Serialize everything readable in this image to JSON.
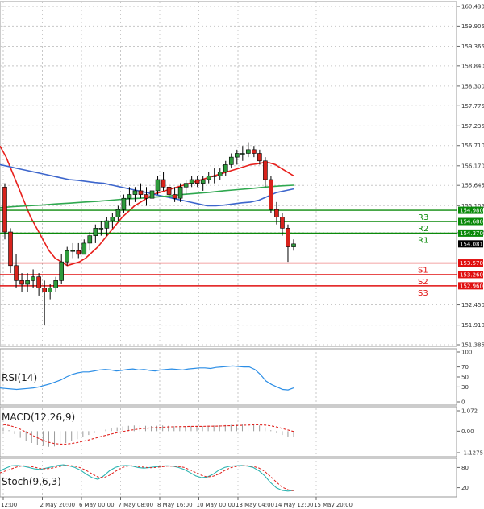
{
  "chart_data": {
    "type": "candlestick",
    "price_axis": {
      "ticks": [
        "160.430",
        "159.905",
        "159.365",
        "158.840",
        "158.300",
        "157.775",
        "157.235",
        "156.710",
        "156.170",
        "155.645",
        "155.105",
        "154.380",
        "152.450",
        "151.910",
        "151.385"
      ],
      "ylim": [
        151.385,
        160.43
      ]
    },
    "x_ticks": [
      "12:00",
      "2 May 20:00",
      "6 May 00:00",
      "7 May 08:00",
      "8 May 16:00",
      "10 May 00:00",
      "13 May 04:00",
      "14 May 12:00",
      "15 May 20:00"
    ],
    "candles": [
      [
        155.6,
        155.7,
        154.2,
        154.4
      ],
      [
        154.4,
        154.5,
        153.3,
        153.5
      ],
      [
        153.5,
        153.8,
        152.9,
        153.1
      ],
      [
        153.1,
        153.3,
        152.8,
        153.0
      ],
      [
        153.0,
        153.3,
        152.8,
        153.1
      ],
      [
        153.1,
        153.4,
        152.9,
        153.2
      ],
      [
        153.2,
        153.3,
        152.7,
        152.9
      ],
      [
        152.9,
        153.1,
        151.9,
        152.8
      ],
      [
        152.8,
        153.0,
        152.6,
        152.9
      ],
      [
        152.9,
        153.2,
        152.8,
        153.1
      ],
      [
        153.1,
        153.8,
        153.0,
        153.6
      ],
      [
        153.6,
        154.0,
        153.5,
        153.9
      ],
      [
        153.9,
        154.1,
        153.7,
        153.9
      ],
      [
        153.9,
        154.1,
        153.7,
        153.8
      ],
      [
        153.8,
        154.2,
        153.8,
        154.1
      ],
      [
        154.1,
        154.4,
        153.9,
        154.3
      ],
      [
        154.3,
        154.6,
        154.1,
        154.5
      ],
      [
        154.5,
        154.7,
        154.3,
        154.5
      ],
      [
        154.5,
        154.8,
        154.3,
        154.7
      ],
      [
        154.7,
        154.9,
        154.5,
        154.8
      ],
      [
        154.8,
        155.1,
        154.7,
        155.0
      ],
      [
        155.0,
        155.4,
        154.9,
        155.3
      ],
      [
        155.3,
        155.6,
        155.1,
        155.4
      ],
      [
        155.4,
        155.6,
        155.2,
        155.5
      ],
      [
        155.5,
        155.7,
        155.3,
        155.4
      ],
      [
        155.4,
        155.6,
        155.1,
        155.3
      ],
      [
        155.3,
        155.6,
        155.2,
        155.5
      ],
      [
        155.5,
        155.9,
        155.4,
        155.8
      ],
      [
        155.8,
        156.0,
        155.5,
        155.6
      ],
      [
        155.6,
        155.7,
        155.3,
        155.4
      ],
      [
        155.4,
        155.6,
        155.2,
        155.3
      ],
      [
        155.3,
        155.7,
        155.2,
        155.6
      ],
      [
        155.6,
        155.8,
        155.4,
        155.7
      ],
      [
        155.7,
        155.9,
        155.6,
        155.8
      ],
      [
        155.8,
        155.9,
        155.6,
        155.7
      ],
      [
        155.7,
        155.9,
        155.5,
        155.8
      ],
      [
        155.8,
        156.0,
        155.7,
        155.9
      ],
      [
        155.9,
        156.1,
        155.7,
        155.9
      ],
      [
        155.9,
        156.1,
        155.8,
        156.0
      ],
      [
        156.0,
        156.3,
        155.9,
        156.2
      ],
      [
        156.2,
        156.5,
        156.1,
        156.4
      ],
      [
        156.4,
        156.6,
        156.2,
        156.5
      ],
      [
        156.5,
        156.7,
        156.3,
        156.5
      ],
      [
        156.5,
        156.8,
        156.4,
        156.6
      ],
      [
        156.6,
        156.7,
        156.4,
        156.5
      ],
      [
        156.5,
        156.6,
        156.2,
        156.3
      ],
      [
        156.3,
        156.4,
        155.6,
        155.8
      ],
      [
        155.8,
        155.9,
        154.9,
        155.0
      ],
      [
        155.0,
        155.2,
        154.6,
        154.8
      ],
      [
        154.8,
        154.9,
        154.3,
        154.5
      ],
      [
        154.5,
        154.6,
        153.6,
        154.0
      ],
      [
        154.0,
        154.2,
        153.9,
        154.08
      ]
    ],
    "moving_averages": [
      {
        "color": "#e8201c",
        "values": [
          156.7,
          156.4,
          156.0,
          155.6,
          155.2,
          154.8,
          154.5,
          154.2,
          153.9,
          153.7,
          153.6,
          153.5,
          153.55,
          153.6,
          153.7,
          153.85,
          154.0,
          154.2,
          154.4,
          154.6,
          154.8,
          154.95,
          155.1,
          155.2,
          155.3,
          155.4,
          155.45,
          155.5,
          155.55,
          155.6,
          155.65,
          155.7,
          155.75,
          155.8,
          155.85,
          155.9,
          155.95,
          156.0,
          156.05,
          156.1,
          156.15,
          156.2,
          156.22,
          156.25,
          156.25,
          156.2,
          156.1,
          156.0,
          155.9
        ]
      },
      {
        "color": "#3d66cc",
        "values": [
          156.2,
          156.15,
          156.1,
          156.05,
          156.0,
          155.95,
          155.9,
          155.85,
          155.8,
          155.78,
          155.75,
          155.72,
          155.7,
          155.65,
          155.6,
          155.55,
          155.5,
          155.45,
          155.4,
          155.35,
          155.3,
          155.25,
          155.2,
          155.15,
          155.1,
          155.1,
          155.12,
          155.15,
          155.18,
          155.2,
          155.25,
          155.35,
          155.45,
          155.5,
          155.55
        ]
      },
      {
        "color": "#2fa84f",
        "values": [
          155.05,
          155.08,
          155.1,
          155.12,
          155.15,
          155.17,
          155.2,
          155.22,
          155.25,
          155.28,
          155.3,
          155.33,
          155.36,
          155.4,
          155.43,
          155.46,
          155.5,
          155.53,
          155.56,
          155.6,
          155.63,
          155.65
        ]
      }
    ],
    "price_tags": [
      {
        "label": "154.980",
        "value": 154.98,
        "color": "#0a8a0a"
      },
      {
        "label": "154.680",
        "value": 154.68,
        "color": "#0a8a0a"
      },
      {
        "label": "154.370",
        "value": 154.37,
        "color": "#0a8a0a"
      },
      {
        "label": "154.081",
        "value": 154.081,
        "color": "#000000"
      },
      {
        "label": "153.570",
        "value": 153.57,
        "color": "#e01010"
      },
      {
        "label": "153.260",
        "value": 153.26,
        "color": "#e01010"
      },
      {
        "label": "152.960",
        "value": 152.96,
        "color": "#e01010"
      }
    ],
    "levels": [
      {
        "label": "R3",
        "value": 154.98,
        "color": "#0a8a0a"
      },
      {
        "label": "R2",
        "value": 154.68,
        "color": "#0a8a0a"
      },
      {
        "label": "R1",
        "value": 154.37,
        "color": "#0a8a0a"
      },
      {
        "label": "S1",
        "value": 153.57,
        "color": "#e01010"
      },
      {
        "label": "S2",
        "value": 153.26,
        "color": "#e01010"
      },
      {
        "label": "S3",
        "value": 152.96,
        "color": "#e01010"
      }
    ],
    "rsi": {
      "title": "RSI(14)",
      "ticks": [
        "100",
        "70",
        "50",
        "30",
        "0"
      ],
      "ylim": [
        0,
        100
      ],
      "values": [
        28,
        27,
        26,
        25,
        26,
        27,
        28,
        30,
        33,
        36,
        40,
        44,
        50,
        55,
        58,
        60,
        60,
        62,
        64,
        65,
        64,
        62,
        63,
        65,
        66,
        64,
        65,
        63,
        62,
        64,
        65,
        66,
        65,
        64,
        66,
        67,
        68,
        68,
        67,
        69,
        70,
        71,
        72,
        71,
        70,
        70,
        65,
        55,
        42,
        35,
        30,
        25,
        24,
        28
      ]
    },
    "macd": {
      "title": "MACD(12,26,9)",
      "ticks": [
        "1.072",
        "0.00",
        "-1.1275"
      ],
      "ylim": [
        -1.1275,
        1.072
      ],
      "histogram": [
        0.2,
        0.05,
        -0.15,
        -0.35,
        -0.5,
        -0.62,
        -0.72,
        -0.78,
        -0.82,
        -0.8,
        -0.72,
        -0.62,
        -0.52,
        -0.42,
        -0.3,
        -0.2,
        -0.1,
        0.0,
        0.08,
        0.15,
        0.2,
        0.25,
        0.28,
        0.3,
        0.3,
        0.28,
        0.27,
        0.28,
        0.3,
        0.28,
        0.26,
        0.25,
        0.26,
        0.27,
        0.28,
        0.27,
        0.28,
        0.3,
        0.31,
        0.32,
        0.33,
        0.34,
        0.35,
        0.35,
        0.34,
        0.3,
        0.2,
        0.05,
        -0.1,
        -0.2,
        -0.28,
        -0.32
      ],
      "signal": [
        0.35,
        0.3,
        0.22,
        0.1,
        -0.05,
        -0.2,
        -0.35,
        -0.48,
        -0.58,
        -0.65,
        -0.68,
        -0.68,
        -0.65,
        -0.6,
        -0.53,
        -0.46,
        -0.38,
        -0.3,
        -0.22,
        -0.15,
        -0.08,
        -0.02,
        0.03,
        0.08,
        0.12,
        0.15,
        0.17,
        0.19,
        0.21,
        0.22,
        0.23,
        0.24,
        0.24,
        0.25,
        0.25,
        0.25,
        0.26,
        0.26,
        0.27,
        0.28,
        0.29,
        0.3,
        0.31,
        0.32,
        0.33,
        0.33,
        0.32,
        0.28,
        0.22,
        0.14,
        0.06,
        -0.02
      ]
    },
    "stoch": {
      "title": "Stoch(9,6,3)",
      "ticks": [
        "80",
        "20"
      ],
      "ylim": [
        0,
        100
      ],
      "k": [
        70,
        78,
        85,
        86,
        84,
        80,
        76,
        74,
        78,
        82,
        86,
        88,
        85,
        80,
        72,
        60,
        50,
        45,
        55,
        70,
        80,
        85,
        86,
        84,
        80,
        78,
        80,
        82,
        84,
        85,
        84,
        80,
        74,
        65,
        55,
        50,
        52,
        60,
        72,
        80,
        84,
        85,
        86,
        84,
        80,
        70,
        55,
        35,
        20,
        12,
        10,
        12
      ],
      "d": [
        64,
        70,
        76,
        82,
        85,
        84,
        81,
        77,
        76,
        78,
        82,
        85,
        86,
        84,
        79,
        71,
        61,
        52,
        50,
        57,
        68,
        78,
        84,
        85,
        83,
        81,
        79,
        80,
        82,
        84,
        84,
        83,
        80,
        73,
        65,
        57,
        52,
        54,
        61,
        71,
        79,
        83,
        85,
        85,
        83,
        78,
        68,
        53,
        37,
        22,
        14,
        11
      ]
    }
  }
}
